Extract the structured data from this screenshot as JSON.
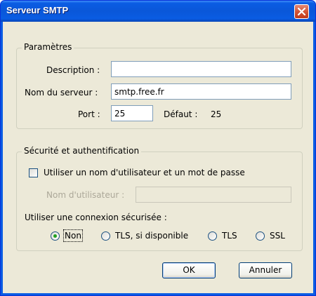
{
  "window": {
    "title": "Serveur SMTP",
    "close_icon": "close-icon"
  },
  "parametres": {
    "title": "Paramètres",
    "description_label": "Description :",
    "description_value": "",
    "server_label": "Nom du serveur :",
    "server_value": "smtp.free.fr",
    "port_label": "Port :",
    "port_value": "25",
    "default_label": "Défaut :",
    "default_value": "25"
  },
  "securite": {
    "title": "Sécurité et authentification",
    "use_auth_label": "Utiliser un nom d'utilisateur et un mot de passe",
    "use_auth_checked": false,
    "username_label": "Nom d'utilisateur :",
    "username_value": "",
    "connection_label": "Utiliser une connexion sécurisée :",
    "options": [
      "Non",
      "TLS, si disponible",
      "TLS",
      "SSL"
    ],
    "selected_option": "Non"
  },
  "buttons": {
    "ok": "OK",
    "cancel": "Annuler"
  },
  "colors": {
    "titlebar": "#0a5ce3",
    "dialog_bg": "#ece9d8",
    "close_button": "#d35435",
    "radio_dot": "#21a121"
  }
}
